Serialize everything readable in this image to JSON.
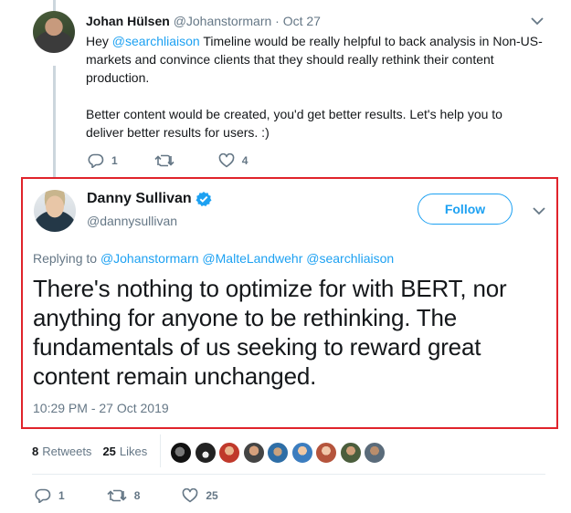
{
  "reply": {
    "name": "Johan Hülsen",
    "handle": "@Johanstormarn",
    "time": "· Oct 27",
    "mention": "@searchliaison",
    "text_line1_rest": " Timeline would be really helpful to back analysis in Non-US-markets and convince clients that they should really rethink their content production.",
    "text_prefix": "Hey ",
    "text_para2": "Better content would be created, you'd get better results. Let's help you to deliver better results for users. :)",
    "reply_count": "1",
    "retweet_count": "",
    "like_count": "4"
  },
  "tweet": {
    "name": "Danny Sullivan",
    "handle": "@dannysullivan",
    "follow_label": "Follow",
    "replying_prefix": "Replying to",
    "replying_mentions": "@Johanstormarn @MalteLandwehr @searchliaison",
    "text": "There's nothing to optimize for with BERT, nor anything for anyone to be rethinking. The fundamentals of us seeking to reward great content remain unchanged.",
    "timestamp": "10:29 PM - 27 Oct 2019",
    "retweets_count": "8",
    "retweets_label": "Retweets",
    "likes_count": "25",
    "likes_label": "Likes",
    "reply_count": "1",
    "retweet_count": "8",
    "like_count": "25"
  },
  "colors": {
    "accent": "#1da1f2",
    "highlight_border": "#e0232b",
    "muted": "#657786"
  },
  "icons": {
    "reply": "reply-icon",
    "retweet": "retweet-icon",
    "like": "heart-icon",
    "verified": "verified-badge-icon",
    "more": "chevron-down-icon"
  }
}
